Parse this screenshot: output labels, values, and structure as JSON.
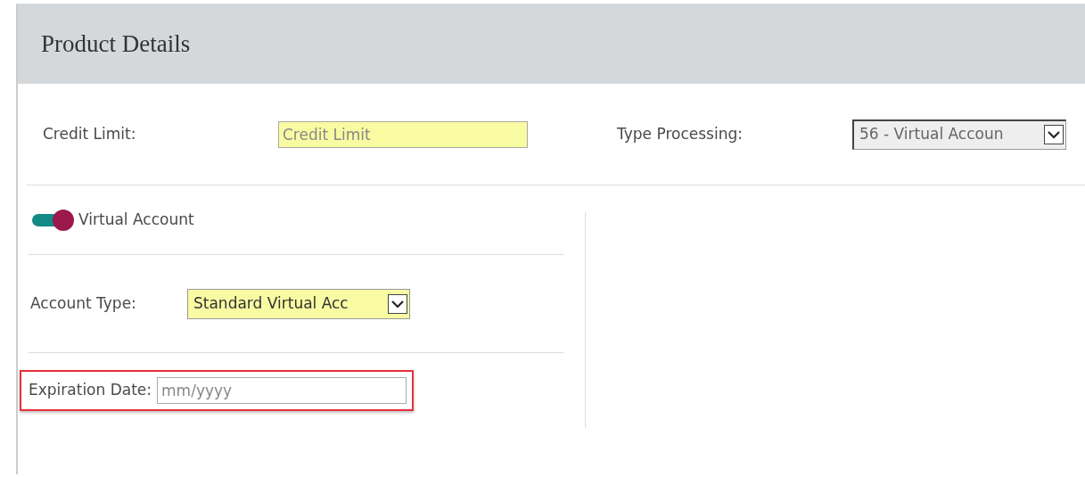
{
  "panel": {
    "title": "Product Details"
  },
  "top_row": [
    {
      "kind": "input",
      "label": "Credit Limit:",
      "placeholder": "Credit Limit",
      "required": true
    },
    {
      "kind": "select",
      "label": "Type Processing:",
      "value": "56 - Virtual Accoun",
      "disabled": true
    }
  ],
  "toggle": {
    "label": "Virtual Account",
    "on": true
  },
  "account_type": {
    "kind": "select",
    "label": "Account Type:",
    "value": "Standard Virtual Acc",
    "required": true
  },
  "expiration": {
    "kind": "input",
    "label": "Expiration Date:",
    "placeholder": "mm/yyyy",
    "highlighted": true
  }
}
